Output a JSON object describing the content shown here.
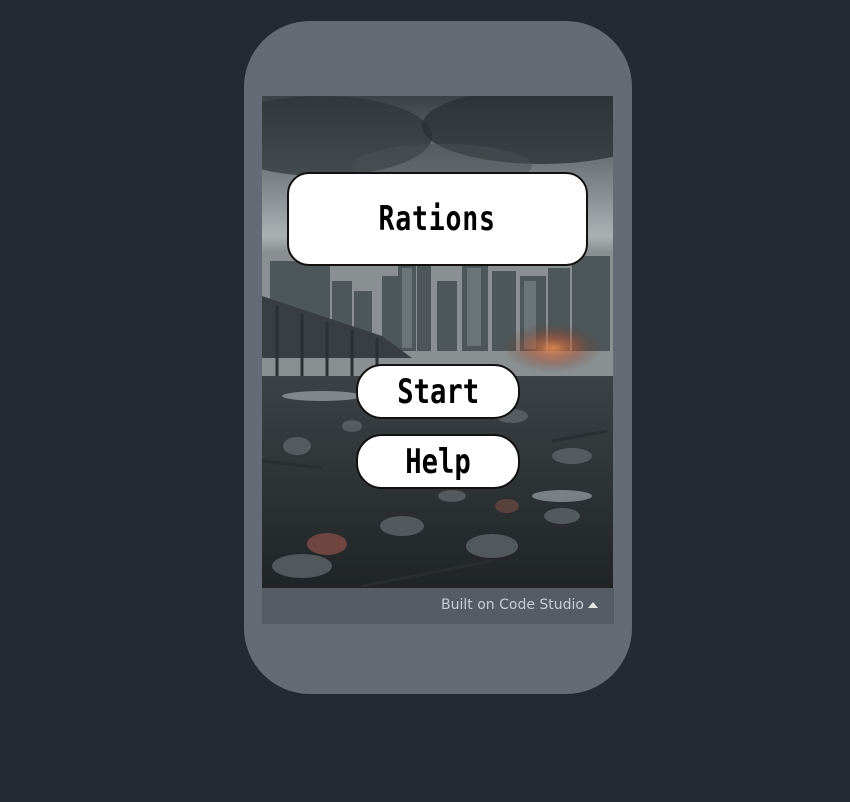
{
  "app": {
    "title": "Rations",
    "buttons": {
      "start": "Start",
      "help": "Help"
    }
  },
  "footer": {
    "label": "Built on Code Studio",
    "icon": "caret-up-icon"
  },
  "background_image": {
    "subject": "ruined-city-background"
  },
  "colors": {
    "page_bg": "#232a34",
    "phone_frame": "#646b75",
    "footer_bg": "#555c66",
    "button_bg": "#ffffff",
    "button_border": "#111111"
  }
}
